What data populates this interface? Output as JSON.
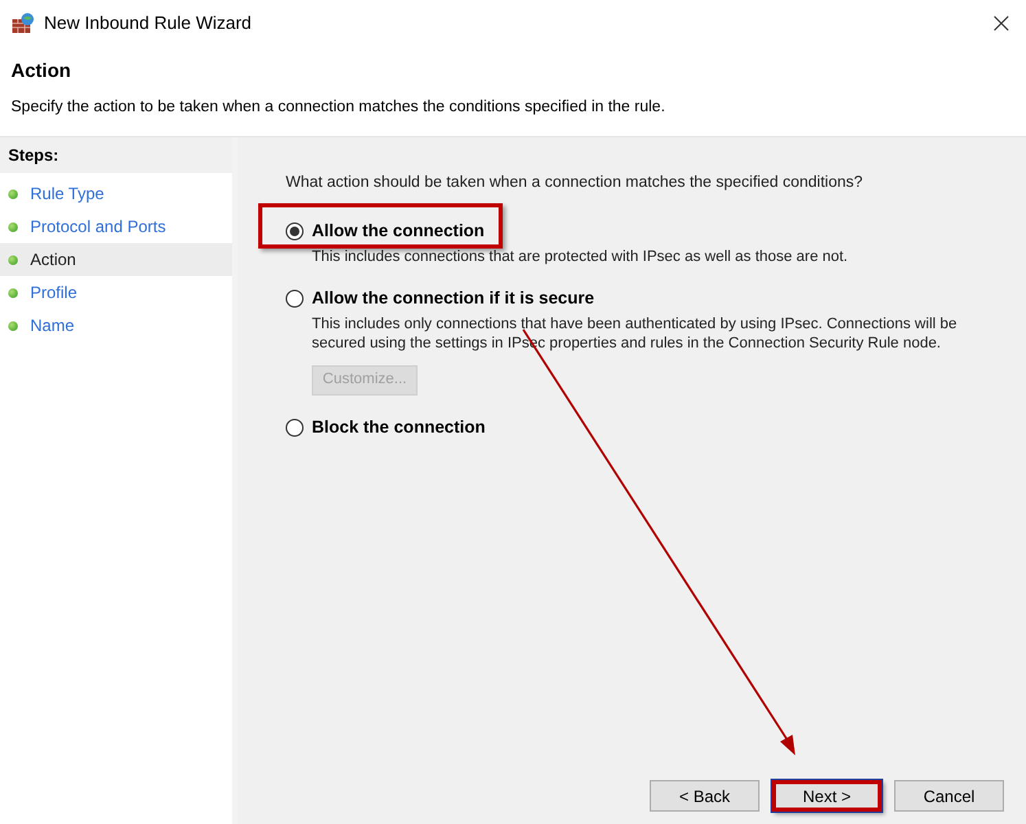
{
  "window": {
    "title": "New Inbound Rule Wizard"
  },
  "header": {
    "title": "Action",
    "description": "Specify the action to be taken when a connection matches the conditions specified in the rule."
  },
  "steps": {
    "heading": "Steps:",
    "items": [
      {
        "label": "Rule Type",
        "selected": false
      },
      {
        "label": "Protocol and Ports",
        "selected": false
      },
      {
        "label": "Action",
        "selected": true
      },
      {
        "label": "Profile",
        "selected": false
      },
      {
        "label": "Name",
        "selected": false
      }
    ]
  },
  "question": "What action should be taken when a connection matches the specified conditions?",
  "options": [
    {
      "label": "Allow the connection",
      "selected": true,
      "annotated": true,
      "description": "This includes connections that are protected with IPsec as well as those are not."
    },
    {
      "label": "Allow the connection if it is secure",
      "selected": false,
      "annotated": false,
      "description": "This includes only connections that have been authenticated by using IPsec.  Connections will be secured using the settings in IPsec properties and rules in the Connection Security Rule node.",
      "button": {
        "label": "Customize...",
        "disabled": true
      }
    },
    {
      "label": "Block the connection",
      "selected": false,
      "annotated": false
    }
  ],
  "buttons": [
    {
      "label": "< Back",
      "annotated": false
    },
    {
      "label": "Next >",
      "annotated": true
    },
    {
      "label": "Cancel",
      "annotated": false
    }
  ]
}
